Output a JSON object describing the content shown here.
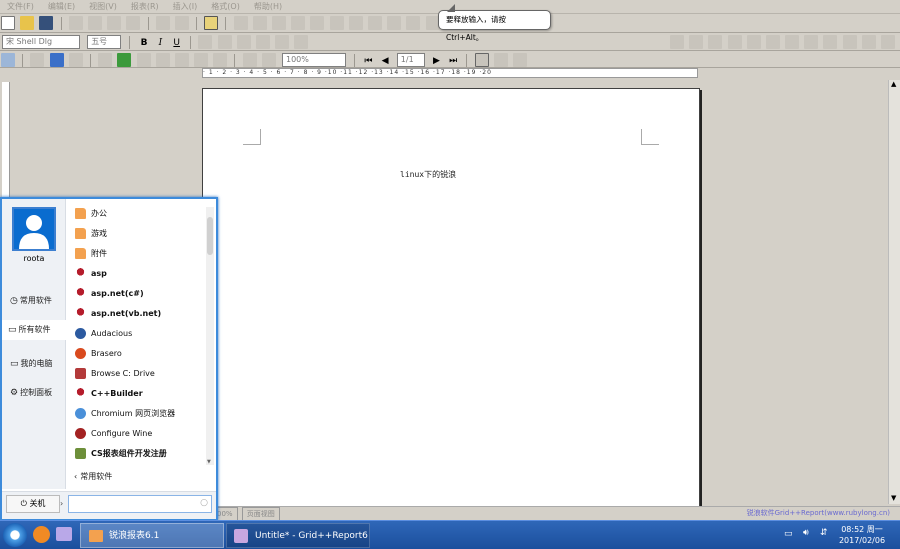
{
  "menubar": {
    "items": [
      "文件(F)",
      "编辑(E)",
      "视图(V)",
      "报表(R)",
      "插入(I)",
      "格式(O)",
      "帮助(H)"
    ]
  },
  "format_toolbar": {
    "font_name": "宋 Shell Dlg",
    "font_size": "五号",
    "bold": "B",
    "italic": "I",
    "underline": "U"
  },
  "report_toolbar": {
    "zoom": "100%",
    "page": "1/1"
  },
  "tooltip": {
    "text": "要释放输入，请按 Ctrl+Alt。"
  },
  "ruler": {
    "text": "· 1 · 2 · 3 · 4 · 5 · 6 · 7 · 8 · 9 ·10 ·11 ·12 ·13 ·14 ·15 ·16 ·17 ·18 ·19 ·20"
  },
  "document": {
    "text": "linux下的锐浪"
  },
  "statusbar": {
    "zoom": "00%",
    "view_mode": "页面视图",
    "credit": "锐浪软件Grid++Report(www.rubylong.cn)"
  },
  "startmenu": {
    "user_name": "roota",
    "nav": [
      {
        "label": "常用软件",
        "icon": "clock-icon",
        "glyph": "◷"
      },
      {
        "label": "所有软件",
        "icon": "apps-icon",
        "glyph": "▭"
      },
      {
        "label": "我的电脑",
        "icon": "computer-icon",
        "glyph": "▭"
      },
      {
        "label": "控制面板",
        "icon": "gear-icon",
        "glyph": "⚙"
      }
    ],
    "items": [
      {
        "label": "办公",
        "icon": "folder-icon",
        "bold": false
      },
      {
        "label": "游戏",
        "icon": "folder-icon",
        "bold": false
      },
      {
        "label": "附件",
        "icon": "folder-icon",
        "bold": false
      },
      {
        "label": "asp",
        "icon": "wine-icon",
        "bold": true
      },
      {
        "label": "asp.net(c#)",
        "icon": "wine-icon",
        "bold": true
      },
      {
        "label": "asp.net(vb.net)",
        "icon": "wine-icon",
        "bold": true
      },
      {
        "label": "Audacious",
        "icon": "audacious-icon",
        "bold": false
      },
      {
        "label": "Brasero",
        "icon": "brasero-icon",
        "bold": false
      },
      {
        "label": "Browse C: Drive",
        "icon": "drive-icon",
        "bold": false
      },
      {
        "label": "C++Builder",
        "icon": "wine-icon",
        "bold": true
      },
      {
        "label": "Chromium 网页浏览器",
        "icon": "chromium-icon",
        "bold": false
      },
      {
        "label": "Configure Wine",
        "icon": "wine-config-icon",
        "bold": false
      },
      {
        "label": "CS报表组件开发注册",
        "icon": "registration-icon",
        "bold": true
      }
    ],
    "back_label": "常用软件",
    "shutdown_label": "关机",
    "search_placeholder": ""
  },
  "taskbar": {
    "windows": [
      {
        "label": "锐浪报表6.1"
      },
      {
        "label": "Untitle* - Grid++Report6 ..."
      }
    ],
    "clock_time": "08:52 周一",
    "clock_date": "2017/02/06"
  },
  "colors": {
    "accent": "#3d8bdb",
    "taskbar": "#2357a8",
    "folder": "#f3a14f",
    "wine": "#b51c2b"
  }
}
